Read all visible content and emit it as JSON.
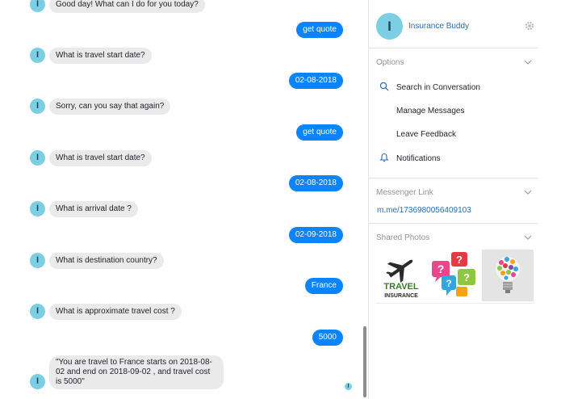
{
  "chat": {
    "messages": [
      {
        "dir": "in",
        "text": "Good day! What can I do for you today?"
      },
      {
        "dir": "out",
        "text": "get quote"
      },
      {
        "dir": "in",
        "text": "What is travel start date?"
      },
      {
        "dir": "out",
        "text": "02-08-2018"
      },
      {
        "dir": "in",
        "text": "Sorry, can you say that again?"
      },
      {
        "dir": "out",
        "text": "get quote"
      },
      {
        "dir": "in",
        "text": "What is travel start date?"
      },
      {
        "dir": "out",
        "text": "02-08-2018"
      },
      {
        "dir": "in",
        "text": "What is arrival date ?"
      },
      {
        "dir": "out",
        "text": "02-09-2018"
      },
      {
        "dir": "in",
        "text": "What is destination country?"
      },
      {
        "dir": "out",
        "text": "France"
      },
      {
        "dir": "in",
        "text": "What is approximate travel cost ?"
      },
      {
        "dir": "out",
        "text": "5000"
      },
      {
        "dir": "in",
        "text": "\"You are travel to France starts on 2018-08-02 and end on 2018-09-02 , and travel cost is 5000\""
      }
    ],
    "avatar_letter": "I"
  },
  "contact": {
    "name": "Insurance Buddy",
    "avatar_letter": "I",
    "settings_icon": "gear-icon"
  },
  "options": {
    "title": "Options",
    "items": [
      {
        "label": "Search in Conversation",
        "icon": "search-icon"
      },
      {
        "label": "Manage Messages",
        "icon": ""
      },
      {
        "label": "Leave Feedback",
        "icon": ""
      },
      {
        "label": "Notifications",
        "icon": "bell-icon"
      }
    ]
  },
  "messenger_link": {
    "title": "Messenger Link",
    "url": "m.me/1736980056409103"
  },
  "shared_photos": {
    "title": "Shared Photos",
    "photos": [
      {
        "caption_line1": "TRAVEL",
        "caption_line2": "INSURANCE"
      },
      {
        "caption_line1": "",
        "caption_line2": ""
      },
      {
        "caption_line1": "",
        "caption_line2": ""
      }
    ]
  },
  "colors": {
    "accent": "#0a84ff",
    "avatar": "#7ccfe3",
    "link": "#2b6dad",
    "bubble_in": "#eaeaea"
  }
}
